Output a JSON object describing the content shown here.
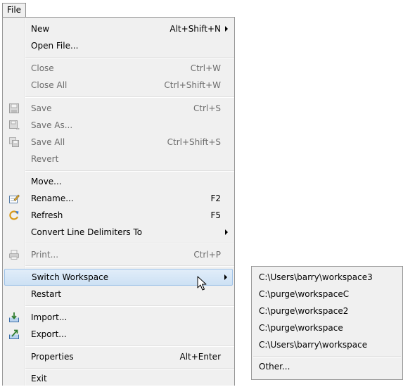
{
  "menubar": {
    "file_label": "File"
  },
  "file_menu": {
    "new": {
      "label": "New",
      "shortcut": "Alt+Shift+N"
    },
    "open_file": {
      "label": "Open File..."
    },
    "close": {
      "label": "Close",
      "shortcut": "Ctrl+W"
    },
    "close_all": {
      "label": "Close All",
      "shortcut": "Ctrl+Shift+W"
    },
    "save": {
      "label": "Save",
      "shortcut": "Ctrl+S"
    },
    "save_as": {
      "label": "Save As..."
    },
    "save_all": {
      "label": "Save All",
      "shortcut": "Ctrl+Shift+S"
    },
    "revert": {
      "label": "Revert"
    },
    "move": {
      "label": "Move..."
    },
    "rename": {
      "label": "Rename...",
      "shortcut": "F2"
    },
    "refresh": {
      "label": "Refresh",
      "shortcut": "F5"
    },
    "convert_line_delimiters": {
      "label": "Convert Line Delimiters To"
    },
    "print": {
      "label": "Print...",
      "shortcut": "Ctrl+P"
    },
    "switch_workspace": {
      "label": "Switch Workspace"
    },
    "restart": {
      "label": "Restart"
    },
    "import": {
      "label": "Import..."
    },
    "export": {
      "label": "Export..."
    },
    "properties": {
      "label": "Properties",
      "shortcut": "Alt+Enter"
    },
    "exit": {
      "label": "Exit"
    }
  },
  "workspace_submenu": {
    "items": [
      "C:\\Users\\barry\\workspace3",
      "C:\\purge\\workspaceC",
      "C:\\purge\\workspace2",
      "C:\\purge\\workspace",
      "C:\\Users\\barry\\workspace"
    ],
    "other": "Other..."
  },
  "icons": {
    "save": "floppy-disk-icon",
    "save_as": "floppy-disk-pencil-icon",
    "save_all": "multiple-floppy-icon",
    "rename": "rename-pencil-icon",
    "refresh": "refresh-icon",
    "print": "printer-icon",
    "import": "import-icon",
    "export": "export-icon"
  },
  "colors": {
    "menu_background": "#f0f0f0",
    "highlight_background": "#d9e8f7",
    "highlight_border": "#9fc3e8",
    "disabled_text": "#6d6d6d"
  }
}
